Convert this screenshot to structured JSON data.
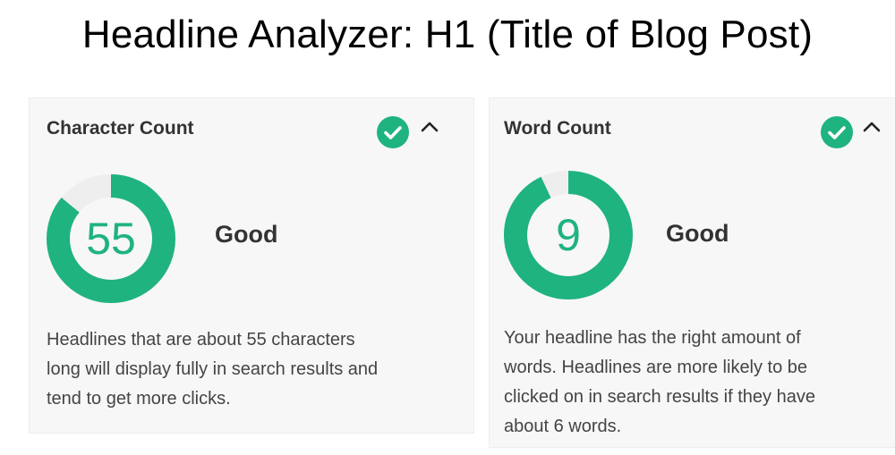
{
  "page": {
    "title": "Headline Analyzer: H1 (Title of Blog Post)"
  },
  "colors": {
    "accent": "#1fb37f",
    "track": "#eeeeee",
    "card_bg": "#f7f7f7"
  },
  "cards": [
    {
      "title": "Character Count",
      "status_icon": "check-circle-icon",
      "toggle_icon": "chevron-up-icon",
      "value": "55",
      "progress": 0.86,
      "rating": "Good",
      "description_lines": [
        "Headlines that are about 55 characters",
        "long will display fully in search results and",
        "tend to get more clicks."
      ]
    },
    {
      "title": "Word Count",
      "status_icon": "check-circle-icon",
      "toggle_icon": "chevron-up-icon",
      "value": "9",
      "progress": 0.93,
      "rating": "Good",
      "description_lines": [
        "Your headline has the right amount of",
        "words. Headlines are more likely to be",
        "clicked on in search results if they have",
        "about 6 words."
      ]
    }
  ]
}
